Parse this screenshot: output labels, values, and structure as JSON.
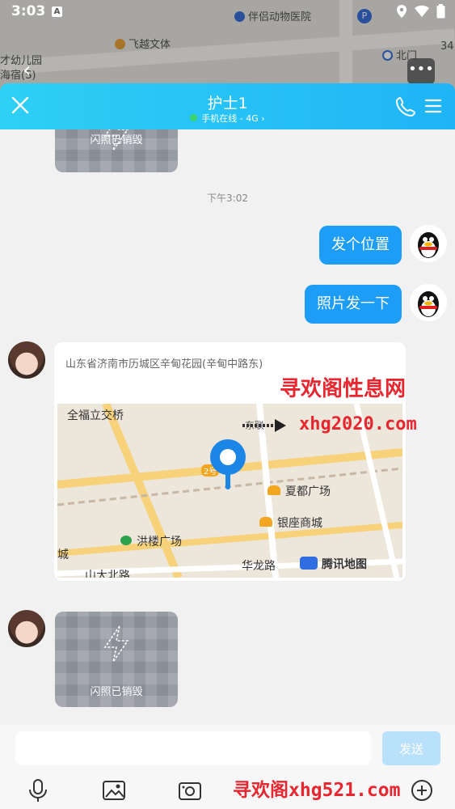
{
  "status_bar": {
    "time": "3:03"
  },
  "background_map": {
    "labels": [
      "伴侣动物医院",
      "飞越文体",
      "才幼儿园",
      "海宿(S)",
      "北门",
      "34"
    ]
  },
  "chat_header": {
    "title": "护士1",
    "subtitle": "手机在线 - 4G",
    "subtitle_arrow": "›",
    "online_color": "#3cd36a"
  },
  "messages": {
    "flash_top_label": "闪照已销毁",
    "timestamp": "下午3:02",
    "outgoing": [
      "发个位置",
      "照片发一下"
    ],
    "location_address": "山东省济南市历城区辛甸花园(辛甸中路东)",
    "location_map_labels": [
      "全福立交桥",
      "夏都广场",
      "银座商城",
      "洪楼广场",
      "城",
      "华龙路",
      "山大北路",
      "腾讯地图",
      "东联",
      "2号"
    ],
    "flash_bottom_label": "闪照已销毁"
  },
  "watermarks": {
    "line1": "寻欢阁性息网",
    "line2": "xhg2020.com",
    "line3": "寻欢阁xhg521.com"
  },
  "input": {
    "placeholder": "",
    "send_label": "发送"
  },
  "colors": {
    "header": "#1fb4f6",
    "bubble": "#1d9df5",
    "send_disabled": "#b9e1fb",
    "pin": "#1b86e6"
  }
}
